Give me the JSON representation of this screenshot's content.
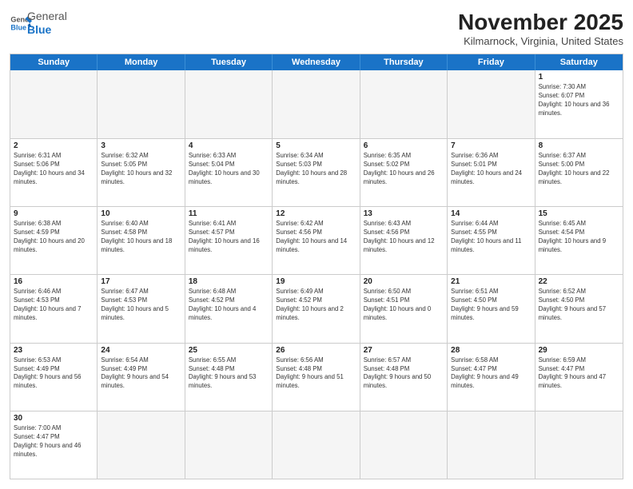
{
  "header": {
    "logo_general": "General",
    "logo_blue": "Blue",
    "month": "November 2025",
    "location": "Kilmarnock, Virginia, United States"
  },
  "weekdays": [
    "Sunday",
    "Monday",
    "Tuesday",
    "Wednesday",
    "Thursday",
    "Friday",
    "Saturday"
  ],
  "rows": [
    [
      {
        "day": "",
        "info": ""
      },
      {
        "day": "",
        "info": ""
      },
      {
        "day": "",
        "info": ""
      },
      {
        "day": "",
        "info": ""
      },
      {
        "day": "",
        "info": ""
      },
      {
        "day": "",
        "info": ""
      },
      {
        "day": "1",
        "info": "Sunrise: 7:30 AM\nSunset: 6:07 PM\nDaylight: 10 hours and 36 minutes."
      }
    ],
    [
      {
        "day": "2",
        "info": "Sunrise: 6:31 AM\nSunset: 5:06 PM\nDaylight: 10 hours and 34 minutes."
      },
      {
        "day": "3",
        "info": "Sunrise: 6:32 AM\nSunset: 5:05 PM\nDaylight: 10 hours and 32 minutes."
      },
      {
        "day": "4",
        "info": "Sunrise: 6:33 AM\nSunset: 5:04 PM\nDaylight: 10 hours and 30 minutes."
      },
      {
        "day": "5",
        "info": "Sunrise: 6:34 AM\nSunset: 5:03 PM\nDaylight: 10 hours and 28 minutes."
      },
      {
        "day": "6",
        "info": "Sunrise: 6:35 AM\nSunset: 5:02 PM\nDaylight: 10 hours and 26 minutes."
      },
      {
        "day": "7",
        "info": "Sunrise: 6:36 AM\nSunset: 5:01 PM\nDaylight: 10 hours and 24 minutes."
      },
      {
        "day": "8",
        "info": "Sunrise: 6:37 AM\nSunset: 5:00 PM\nDaylight: 10 hours and 22 minutes."
      }
    ],
    [
      {
        "day": "9",
        "info": "Sunrise: 6:38 AM\nSunset: 4:59 PM\nDaylight: 10 hours and 20 minutes."
      },
      {
        "day": "10",
        "info": "Sunrise: 6:40 AM\nSunset: 4:58 PM\nDaylight: 10 hours and 18 minutes."
      },
      {
        "day": "11",
        "info": "Sunrise: 6:41 AM\nSunset: 4:57 PM\nDaylight: 10 hours and 16 minutes."
      },
      {
        "day": "12",
        "info": "Sunrise: 6:42 AM\nSunset: 4:56 PM\nDaylight: 10 hours and 14 minutes."
      },
      {
        "day": "13",
        "info": "Sunrise: 6:43 AM\nSunset: 4:56 PM\nDaylight: 10 hours and 12 minutes."
      },
      {
        "day": "14",
        "info": "Sunrise: 6:44 AM\nSunset: 4:55 PM\nDaylight: 10 hours and 11 minutes."
      },
      {
        "day": "15",
        "info": "Sunrise: 6:45 AM\nSunset: 4:54 PM\nDaylight: 10 hours and 9 minutes."
      }
    ],
    [
      {
        "day": "16",
        "info": "Sunrise: 6:46 AM\nSunset: 4:53 PM\nDaylight: 10 hours and 7 minutes."
      },
      {
        "day": "17",
        "info": "Sunrise: 6:47 AM\nSunset: 4:53 PM\nDaylight: 10 hours and 5 minutes."
      },
      {
        "day": "18",
        "info": "Sunrise: 6:48 AM\nSunset: 4:52 PM\nDaylight: 10 hours and 4 minutes."
      },
      {
        "day": "19",
        "info": "Sunrise: 6:49 AM\nSunset: 4:52 PM\nDaylight: 10 hours and 2 minutes."
      },
      {
        "day": "20",
        "info": "Sunrise: 6:50 AM\nSunset: 4:51 PM\nDaylight: 10 hours and 0 minutes."
      },
      {
        "day": "21",
        "info": "Sunrise: 6:51 AM\nSunset: 4:50 PM\nDaylight: 9 hours and 59 minutes."
      },
      {
        "day": "22",
        "info": "Sunrise: 6:52 AM\nSunset: 4:50 PM\nDaylight: 9 hours and 57 minutes."
      }
    ],
    [
      {
        "day": "23",
        "info": "Sunrise: 6:53 AM\nSunset: 4:49 PM\nDaylight: 9 hours and 56 minutes."
      },
      {
        "day": "24",
        "info": "Sunrise: 6:54 AM\nSunset: 4:49 PM\nDaylight: 9 hours and 54 minutes."
      },
      {
        "day": "25",
        "info": "Sunrise: 6:55 AM\nSunset: 4:48 PM\nDaylight: 9 hours and 53 minutes."
      },
      {
        "day": "26",
        "info": "Sunrise: 6:56 AM\nSunset: 4:48 PM\nDaylight: 9 hours and 51 minutes."
      },
      {
        "day": "27",
        "info": "Sunrise: 6:57 AM\nSunset: 4:48 PM\nDaylight: 9 hours and 50 minutes."
      },
      {
        "day": "28",
        "info": "Sunrise: 6:58 AM\nSunset: 4:47 PM\nDaylight: 9 hours and 49 minutes."
      },
      {
        "day": "29",
        "info": "Sunrise: 6:59 AM\nSunset: 4:47 PM\nDaylight: 9 hours and 47 minutes."
      }
    ],
    [
      {
        "day": "30",
        "info": "Sunrise: 7:00 AM\nSunset: 4:47 PM\nDaylight: 9 hours and 46 minutes."
      },
      {
        "day": "",
        "info": ""
      },
      {
        "day": "",
        "info": ""
      },
      {
        "day": "",
        "info": ""
      },
      {
        "day": "",
        "info": ""
      },
      {
        "day": "",
        "info": ""
      },
      {
        "day": "",
        "info": ""
      }
    ]
  ]
}
